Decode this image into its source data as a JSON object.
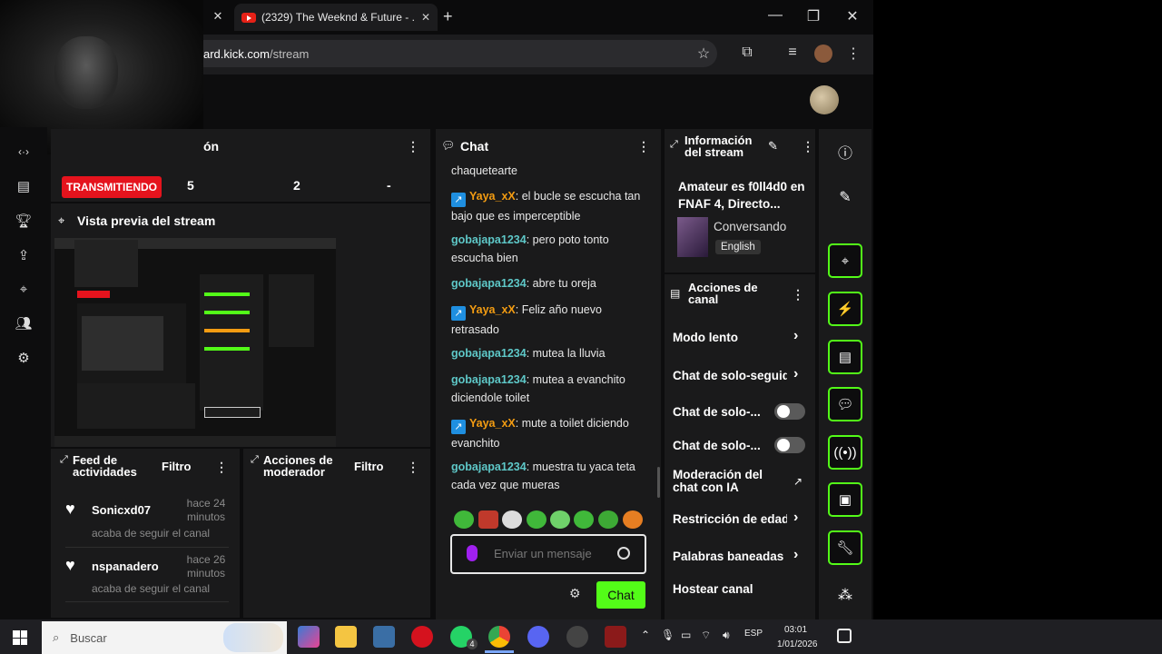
{
  "browser": {
    "tab_title": "(2329) The Weeknd & Future - ...",
    "url_domain": "ard.kick.com",
    "url_path": "/stream"
  },
  "dashboard": {
    "section_fragment": "ón",
    "status_badge": "TRANSMITIENDO",
    "stats": [
      "5",
      "2",
      "-"
    ],
    "preview_title": "Vista previa del stream"
  },
  "activity_feed": {
    "title": "Feed de actividades",
    "filter": "Filtro",
    "items": [
      {
        "user": "Sonicxd07",
        "ago": "hace 24 minutos",
        "action": "acaba de seguir el canal"
      },
      {
        "user": "nspanadero",
        "ago": "hace 26 minutos",
        "action": "acaba de seguir el canal"
      }
    ]
  },
  "mod_actions": {
    "title": "Acciones de moderador",
    "filter": "Filtro"
  },
  "chat": {
    "title": "Chat",
    "messages": [
      {
        "user": "",
        "text": "chaquetearte",
        "color": "none"
      },
      {
        "user": "Yaya_xX",
        "text": ": el bucle se escucha tan bajo que es imperceptible",
        "color": "orange",
        "badge": true
      },
      {
        "user": "gobajapa1234",
        "text": ": pero poto tonto escucha bien",
        "color": "cyan"
      },
      {
        "user": "gobajapa1234",
        "text": ": abre tu oreja",
        "color": "cyan"
      },
      {
        "user": "Yaya_xX",
        "text": ": Feliz año nuevo retrasado",
        "color": "orange",
        "badge": true
      },
      {
        "user": "gobajapa1234",
        "text": ": mutea la lluvia",
        "color": "cyan"
      },
      {
        "user": "gobajapa1234",
        "text": ": mutea a evanchito diciendole toilet",
        "color": "cyan"
      },
      {
        "user": "Yaya_xX",
        "text": ": mute a toilet diciendo evanchito",
        "color": "orange",
        "badge": true
      },
      {
        "user": "gobajapa1234",
        "text": ": muestra tu yaca teta cada vez que mueras",
        "color": "cyan"
      }
    ],
    "input_placeholder": "Enviar un mensaje",
    "send_label": "Chat"
  },
  "stream_info": {
    "title": "Información del stream",
    "stream_title": "Amateur es f0ll4d0 en FNAF 4, Directo...",
    "category": "Conversando",
    "language": "English"
  },
  "channel_actions": {
    "title": "Acciones de canal",
    "rows": [
      {
        "label": "Modo lento",
        "control": "chevron"
      },
      {
        "label": "Chat de solo-seguid",
        "control": "chevron"
      },
      {
        "label": "Chat de solo-...",
        "control": "toggle"
      },
      {
        "label": "Chat de solo-...",
        "control": "toggle"
      },
      {
        "label": "Moderación del chat con IA",
        "control": "external"
      },
      {
        "label": "Restricción de edad",
        "control": "chevron"
      },
      {
        "label": "Palabras baneadas",
        "control": "chevron"
      },
      {
        "label": "Hostear canal",
        "control": "none"
      }
    ]
  },
  "taskbar": {
    "search_placeholder": "Buscar",
    "lang": "ESP",
    "time": "03:01",
    "date": "1/01/2026",
    "whatsapp_badge": "4"
  },
  "colors": {
    "accent": "#53fc18",
    "live": "#e5131d",
    "panel": "#1a1a1b"
  }
}
